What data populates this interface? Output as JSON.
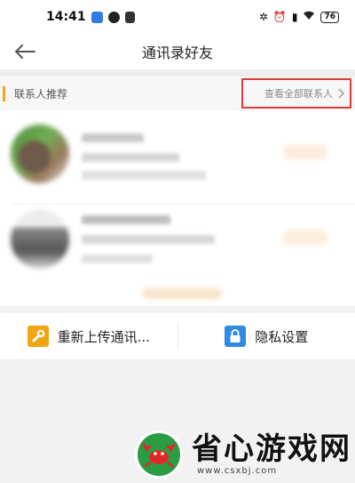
{
  "status_bar": {
    "time": "14:41",
    "battery": "76",
    "icons": [
      "notification-app-icon",
      "notification-app-icon",
      "notification-doc-icon",
      "bluetooth-icon",
      "alarm-icon",
      "signal-icon",
      "wifi-icon",
      "battery-icon"
    ]
  },
  "nav": {
    "title": "通讯录好友",
    "back_icon": "back-arrow-icon"
  },
  "recommend": {
    "title": "联系人推荐",
    "view_all_label": "查看全部联系人",
    "view_all_icon": "chevron-right-icon",
    "highlight_color": "#e03a3a",
    "accent_color": "#f0a42a"
  },
  "toolbar": {
    "reupload_label": "重新上传通讯...",
    "reupload_icon": "wrench-icon",
    "privacy_label": "隐私设置",
    "privacy_icon": "lock-icon"
  },
  "watermark": {
    "text": "省心游戏网",
    "url": "www.csxbj.com",
    "logo_icon": "crab-logo-icon"
  }
}
